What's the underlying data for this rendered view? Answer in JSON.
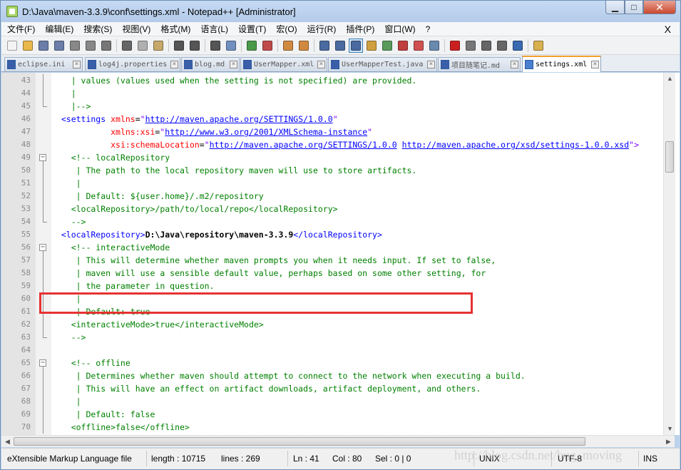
{
  "window": {
    "title": "D:\\Java\\maven-3.3.9\\conf\\settings.xml - Notepad++ [Administrator]"
  },
  "menu": [
    "文件(F)",
    "编辑(E)",
    "搜索(S)",
    "视图(V)",
    "格式(M)",
    "语言(L)",
    "设置(T)",
    "宏(O)",
    "运行(R)",
    "插件(P)",
    "窗口(W)",
    "?"
  ],
  "menu_close": "X",
  "toolbar": {
    "groups": [
      [
        {
          "name": "new-file",
          "color": "#f4f4f4"
        },
        {
          "name": "open-file",
          "color": "#e8b84a"
        },
        {
          "name": "save",
          "color": "#6b7da8"
        },
        {
          "name": "save-all",
          "color": "#6b7da8"
        },
        {
          "name": "close",
          "color": "#888888"
        },
        {
          "name": "close-all",
          "color": "#888888"
        },
        {
          "name": "print",
          "color": "#777777"
        }
      ],
      [
        {
          "name": "cut",
          "color": "#666666"
        },
        {
          "name": "copy",
          "color": "#b0b0b0"
        },
        {
          "name": "paste",
          "color": "#c6a86a"
        }
      ],
      [
        {
          "name": "undo",
          "color": "#555555"
        },
        {
          "name": "redo",
          "color": "#555555"
        }
      ],
      [
        {
          "name": "find",
          "color": "#555555"
        },
        {
          "name": "replace",
          "color": "#7090c0"
        }
      ],
      [
        {
          "name": "zoom-in",
          "color": "#4a9a4a"
        },
        {
          "name": "zoom-out",
          "color": "#c04a4a"
        }
      ],
      [
        {
          "name": "sync-vertical",
          "color": "#d08a40"
        },
        {
          "name": "sync-horizontal",
          "color": "#d08a40"
        }
      ],
      [
        {
          "name": "word-wrap",
          "color": "#4a6aa0"
        },
        {
          "name": "show-all-chars",
          "color": "#4a6aa0"
        },
        {
          "name": "indent-guide",
          "color": "#4a6aa0",
          "active": true
        },
        {
          "name": "udl",
          "color": "#d0a040"
        },
        {
          "name": "doc-map",
          "color": "#5a9a5a"
        },
        {
          "name": "function-list",
          "color": "#c04040"
        },
        {
          "name": "folder-workspace",
          "color": "#d05050"
        },
        {
          "name": "monitoring",
          "color": "#6a8ab0"
        }
      ],
      [
        {
          "name": "record-macro",
          "color": "#cc2020"
        },
        {
          "name": "stop-macro",
          "color": "#777777"
        },
        {
          "name": "play-macro",
          "color": "#666666"
        },
        {
          "name": "play-macro-multiple",
          "color": "#666666"
        },
        {
          "name": "save-macro",
          "color": "#3a6ab0"
        }
      ],
      [
        {
          "name": "extra",
          "color": "#d8b050"
        }
      ]
    ]
  },
  "tabs": [
    {
      "label": "eclipse.ini",
      "active": false
    },
    {
      "label": "log4j.properties",
      "active": false
    },
    {
      "label": "blog.md",
      "active": false
    },
    {
      "label": "UserMapper.xml",
      "active": false
    },
    {
      "label": "UserMapperTest.java",
      "active": false
    },
    {
      "label": "项目随笔记.md",
      "active": false
    },
    {
      "label": "settings.xml",
      "active": true
    }
  ],
  "editor": {
    "lines": [
      {
        "n": "43",
        "fold": "line",
        "segs": [
          {
            "c": "cm",
            "t": "    | values (values used when the setting is not specified) are provided."
          }
        ]
      },
      {
        "n": "44",
        "fold": "line",
        "segs": [
          {
            "c": "cm",
            "t": "    |"
          }
        ]
      },
      {
        "n": "45",
        "fold": "end",
        "segs": [
          {
            "c": "cm",
            "t": "    |-->"
          }
        ]
      },
      {
        "n": "46",
        "fold": "",
        "segs": [
          {
            "c": "tag",
            "t": "  <settings "
          },
          {
            "c": "attr",
            "t": "xmlns"
          },
          {
            "c": "txt",
            "t": "="
          },
          {
            "c": "str",
            "t": "\""
          },
          {
            "c": "url",
            "t": "http://maven.apache.org/SETTINGS/1.0.0"
          },
          {
            "c": "str",
            "t": "\""
          }
        ]
      },
      {
        "n": "47",
        "fold": "",
        "segs": [
          {
            "c": "txt",
            "t": "            "
          },
          {
            "c": "attr",
            "t": "xmlns:xsi"
          },
          {
            "c": "txt",
            "t": "="
          },
          {
            "c": "str",
            "t": "\""
          },
          {
            "c": "url",
            "t": "http://www.w3.org/2001/XMLSchema-instance"
          },
          {
            "c": "str",
            "t": "\""
          }
        ]
      },
      {
        "n": "48",
        "fold": "",
        "segs": [
          {
            "c": "txt",
            "t": "            "
          },
          {
            "c": "attr",
            "t": "xsi:schemaLocation"
          },
          {
            "c": "txt",
            "t": "="
          },
          {
            "c": "str",
            "t": "\""
          },
          {
            "c": "url",
            "t": "http://maven.apache.org/SETTINGS/1.0.0"
          },
          {
            "c": "str",
            "t": " "
          },
          {
            "c": "url",
            "t": "http://maven.apache.org/xsd/settings-1.0.0.xsd"
          },
          {
            "c": "str",
            "t": "\">"
          }
        ]
      },
      {
        "n": "49",
        "fold": "minus",
        "segs": [
          {
            "c": "cm",
            "t": "    <!-- localRepository"
          }
        ]
      },
      {
        "n": "50",
        "fold": "line",
        "segs": [
          {
            "c": "cm",
            "t": "     | The path to the local repository maven will use to store artifacts."
          }
        ]
      },
      {
        "n": "51",
        "fold": "line",
        "segs": [
          {
            "c": "cm",
            "t": "     |"
          }
        ]
      },
      {
        "n": "52",
        "fold": "line",
        "segs": [
          {
            "c": "cm",
            "t": "     | Default: ${user.home}/.m2/repository"
          }
        ]
      },
      {
        "n": "53",
        "fold": "line",
        "segs": [
          {
            "c": "cm",
            "t": "    <localRepository>/path/to/local/repo</localRepository>"
          }
        ]
      },
      {
        "n": "54",
        "fold": "end",
        "segs": [
          {
            "c": "cm",
            "t": "    -->"
          }
        ]
      },
      {
        "n": "55",
        "fold": "",
        "segs": [
          {
            "c": "tag",
            "t": "  <localRepository>"
          },
          {
            "c": "txt b",
            "t": "D:\\Java\\repository\\maven-3.3.9"
          },
          {
            "c": "tag",
            "t": "</localRepository>"
          }
        ]
      },
      {
        "n": "56",
        "fold": "minus",
        "segs": [
          {
            "c": "cm",
            "t": "    <!-- interactiveMode"
          }
        ]
      },
      {
        "n": "57",
        "fold": "line",
        "segs": [
          {
            "c": "cm",
            "t": "     | This will determine whether maven prompts you when it needs input. If set to false,"
          }
        ]
      },
      {
        "n": "58",
        "fold": "line",
        "segs": [
          {
            "c": "cm",
            "t": "     | maven will use a sensible default value, perhaps based on some other setting, for"
          }
        ]
      },
      {
        "n": "59",
        "fold": "line",
        "segs": [
          {
            "c": "cm",
            "t": "     | the parameter in question."
          }
        ]
      },
      {
        "n": "60",
        "fold": "line",
        "segs": [
          {
            "c": "cm",
            "t": "     |"
          }
        ]
      },
      {
        "n": "61",
        "fold": "line",
        "segs": [
          {
            "c": "cm",
            "t": "     | Default: true"
          }
        ]
      },
      {
        "n": "62",
        "fold": "line",
        "segs": [
          {
            "c": "cm",
            "t": "    <interactiveMode>true</interactiveMode>"
          }
        ]
      },
      {
        "n": "63",
        "fold": "end",
        "segs": [
          {
            "c": "cm",
            "t": "    -->"
          }
        ]
      },
      {
        "n": "64",
        "fold": "",
        "segs": [
          {
            "c": "txt",
            "t": ""
          }
        ]
      },
      {
        "n": "65",
        "fold": "minus",
        "segs": [
          {
            "c": "cm",
            "t": "    <!-- offline"
          }
        ]
      },
      {
        "n": "66",
        "fold": "line",
        "segs": [
          {
            "c": "cm",
            "t": "     | Determines whether maven should attempt to connect to the network when executing a build."
          }
        ]
      },
      {
        "n": "67",
        "fold": "line",
        "segs": [
          {
            "c": "cm",
            "t": "     | This will have an effect on artifact downloads, artifact deployment, and others."
          }
        ]
      },
      {
        "n": "68",
        "fold": "line",
        "segs": [
          {
            "c": "cm",
            "t": "     |"
          }
        ]
      },
      {
        "n": "69",
        "fold": "line",
        "segs": [
          {
            "c": "cm",
            "t": "     | Default: false"
          }
        ]
      },
      {
        "n": "70",
        "fold": "line",
        "segs": [
          {
            "c": "cm",
            "t": "    <offline>false</offline>"
          }
        ]
      }
    ]
  },
  "status": {
    "file_type": "eXtensible Markup Language file",
    "length": "length : 10715",
    "lines": "lines : 269",
    "ln": "Ln : 41",
    "col": "Col : 80",
    "sel": "Sel : 0 | 0",
    "eol": "UNIX",
    "encoding": "UTF-8",
    "mode": "INS"
  },
  "watermark": "http://blog.csdn.net/bug_moving",
  "colors": {
    "highlight_box": "#e63232",
    "comment": "#008000",
    "tag": "#0000ff",
    "attribute": "#ff0000",
    "string": "#8000ff"
  }
}
